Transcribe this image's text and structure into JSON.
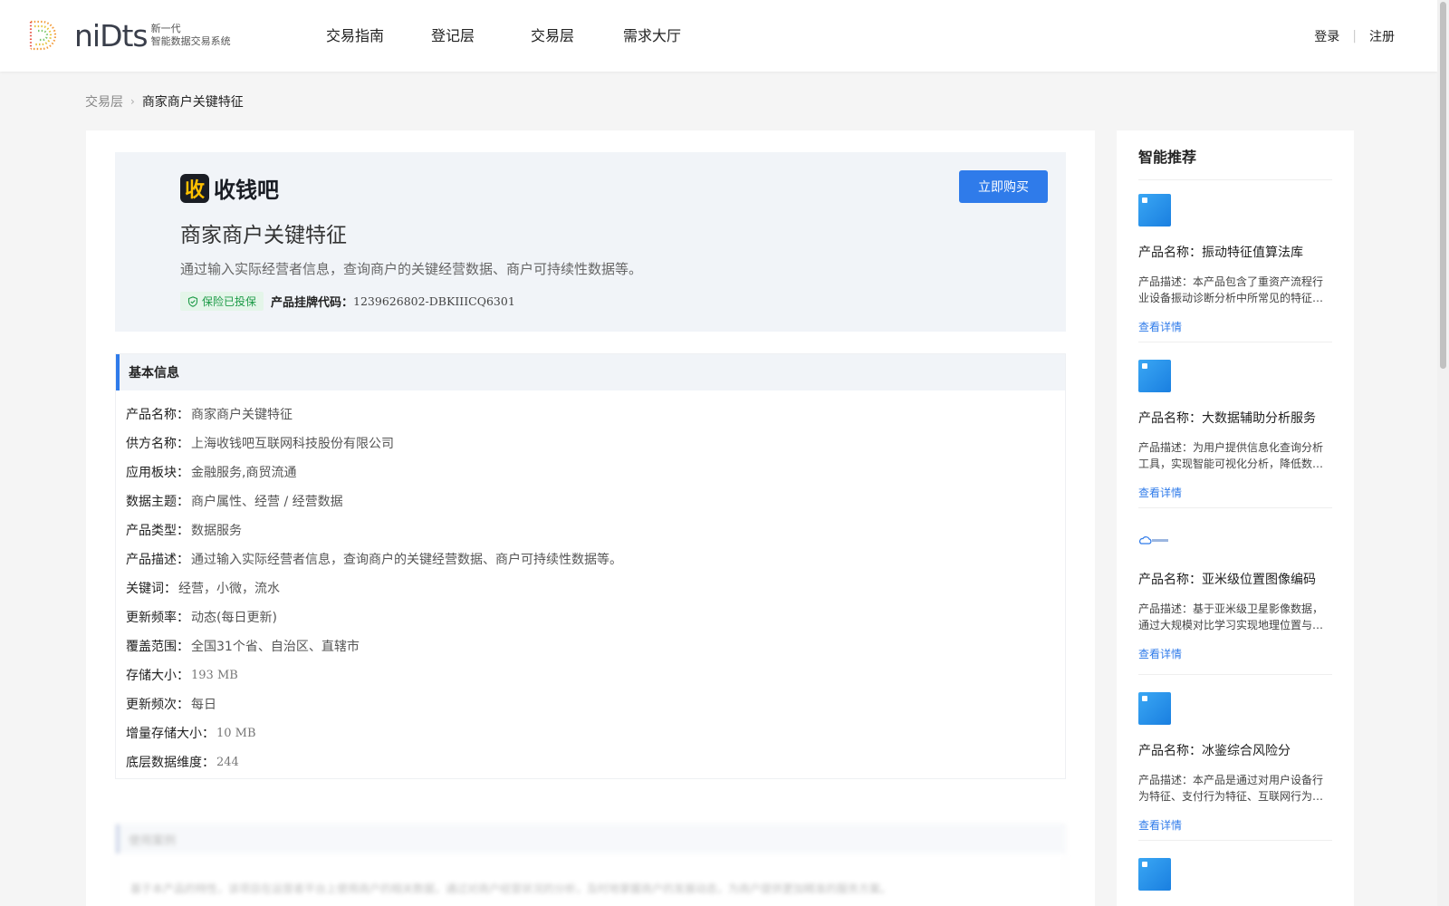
{
  "header": {
    "logo_word": "niDts",
    "logo_sub_line1": "新一代",
    "logo_sub_line2": "智能数据交易系统",
    "nav": [
      "交易指南",
      "登记层",
      "交易层",
      "需求大厅"
    ],
    "login": "登录",
    "register": "注册"
  },
  "breadcrumb": {
    "parent": "交易层",
    "current": "商家商户关键特征"
  },
  "product": {
    "brand_mark": "收",
    "brand_name": "收钱吧",
    "title": "商家商户关键特征",
    "description": "通过输入实际经营者信息，查询商户的关键经营数据、商户可持续性数据等。",
    "insurance_badge": "保险已投保",
    "listing_code_label": "产品挂牌代码：",
    "listing_code": "1239626802-DBKIIICQ6301",
    "buy_button": "立即购买"
  },
  "basic_info": {
    "heading": "基本信息",
    "rows": [
      {
        "k": "产品名称：",
        "v": "商家商户关键特征"
      },
      {
        "k": "供方名称：",
        "v": "上海收钱吧互联网科技股份有限公司"
      },
      {
        "k": "应用板块：",
        "v": "金融服务,商贸流通"
      },
      {
        "k": "数据主题：",
        "v": "商户属性、经营 / 经营数据"
      },
      {
        "k": "产品类型：",
        "v": "数据服务"
      },
      {
        "k": "产品描述：",
        "v": "通过输入实际经营者信息，查询商户的关键经营数据、商户可持续性数据等。"
      },
      {
        "k": "关键词：",
        "v": "经营，小微，流水"
      },
      {
        "k": "更新频率：",
        "v": "动态(每日更新)"
      },
      {
        "k": "覆盖范围：",
        "v": "全国31个省、自治区、直辖市"
      },
      {
        "k": "存储大小：",
        "v": "193 MB"
      },
      {
        "k": "更新频次：",
        "v": "每日"
      },
      {
        "k": "增量存储大小：",
        "v": "10 MB"
      },
      {
        "k": "底层数据维度：",
        "v": "244"
      }
    ]
  },
  "blurred_section": {
    "heading": "使用案例",
    "text": "基于本产品的特性，该项目在运营者平台上使用商户的相关数据，通过对商户经营状况的分析，及时地掌握商户的发展动态，为商户提供更加精准的服务方案。"
  },
  "sidebar": {
    "title": "智能推荐",
    "detail_link": "查看详情",
    "items": [
      {
        "name": "产品名称：振动特征值算法库",
        "desc": "产品描述：本产品包含了重资产流程行业设备振动诊断分析中所常见的特征…"
      },
      {
        "name": "产品名称：大数据辅助分析服务",
        "desc": "产品描述：为用户提供信息化查询分析工具，实现智能可视化分析，降低数…"
      },
      {
        "name": "产品名称：亚米级位置图像编码",
        "desc": "产品描述：基于亚米级卫星影像数据，通过大规模对比学习实现地理位置与…"
      },
      {
        "name": "产品名称：冰鉴综合风险分",
        "desc": "产品描述：本产品是通过对用户设备行为特征、支付行为特征、互联网行为…"
      }
    ]
  },
  "colors": {
    "accent": "#2f7bea",
    "badge_green": "#1b9a46",
    "brand_yellow": "#ffc000"
  }
}
